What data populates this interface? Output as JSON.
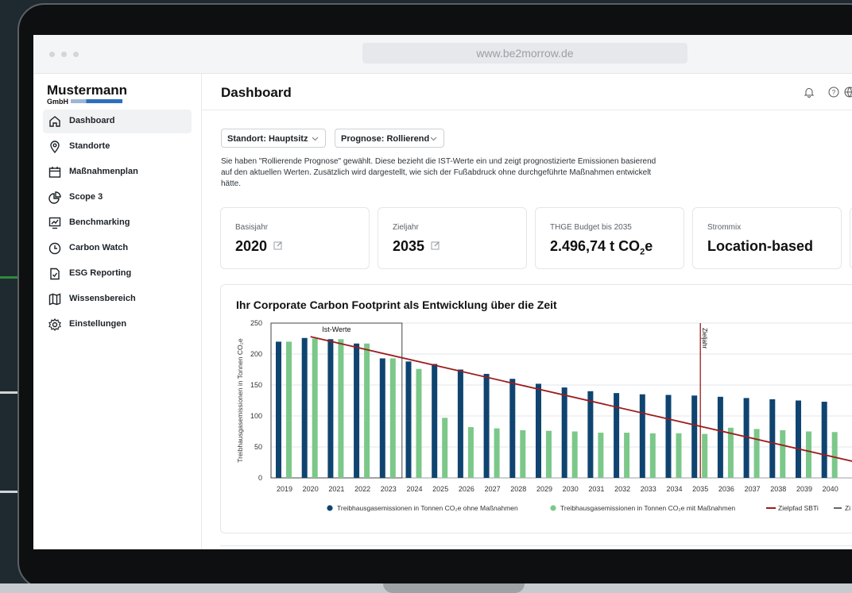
{
  "browser": {
    "url": "www.be2morrow.de"
  },
  "company": {
    "name": "Mustermann",
    "suffix": "GmbH"
  },
  "sidebar": {
    "items": [
      {
        "label": "Dashboard",
        "icon": "home-icon",
        "active": true
      },
      {
        "label": "Standorte",
        "icon": "location-pin-icon"
      },
      {
        "label": "Maßnahmenplan",
        "icon": "calendar-icon"
      },
      {
        "label": "Scope 3",
        "icon": "pie-chart-icon"
      },
      {
        "label": "Benchmarking",
        "icon": "chart-board-icon"
      },
      {
        "label": "Carbon Watch",
        "icon": "clock-icon"
      },
      {
        "label": "ESG Reporting",
        "icon": "document-check-icon"
      },
      {
        "label": "Wissensbereich",
        "icon": "map-icon"
      },
      {
        "label": "Einstellungen",
        "icon": "gear-icon"
      }
    ]
  },
  "header": {
    "title": "Dashboard",
    "icons": [
      "bell-icon",
      "help-icon",
      "globe-icon"
    ]
  },
  "filters": {
    "standort": "Standort: Hauptsitz",
    "prognose": "Prognose: Rollierend"
  },
  "description": "Sie haben \"Rollierende Prognose\" gewählt. Diese bezieht die IST-Werte ein und zeigt prognostizierte Emissionen basierend auf den aktuellen Werten. Zusätzlich wird dargestellt, wie sich der Fußabdruck ohne durchgeführte Maßnahmen entwickelt hätte.",
  "cards": {
    "basisjahr": {
      "label": "Basisjahr",
      "value": "2020"
    },
    "zieljahr": {
      "label": "Zieljahr",
      "value": "2035"
    },
    "budget": {
      "label": "THGE Budget bis 2035",
      "value": "2.496,74 t CO",
      "sub": "2",
      "unit": "e"
    },
    "strommix": {
      "label": "Strommix",
      "value": "Location-based"
    }
  },
  "colors": {
    "dark": "#0f4470",
    "light": "#7cc88a",
    "target": "#9b1c1c",
    "grid": "#e2e5e8"
  },
  "chart_data": {
    "type": "bar",
    "title": "Ihr Corporate Carbon Footprint als Entwicklung über die Zeit",
    "ylabel": "Treibhausgasemissionen in Tonnen CO₂e",
    "ylim": [
      0,
      250
    ],
    "yticks": [
      0,
      50,
      100,
      150,
      200,
      250
    ],
    "categories": [
      "2019",
      "2020",
      "2021",
      "2022",
      "2023",
      "2024",
      "2025",
      "2026",
      "2027",
      "2028",
      "2029",
      "2030",
      "2031",
      "2032",
      "2033",
      "2034",
      "2035",
      "2036",
      "2037",
      "2038",
      "2039",
      "2040"
    ],
    "series": [
      {
        "name": "Treibhausgasemissionen in Tonnen CO₂e ohne Maßnahmen",
        "color": "#0f4470",
        "values": [
          220,
          226,
          224,
          217,
          193,
          188,
          184,
          175,
          168,
          160,
          152,
          146,
          140,
          137,
          135,
          134,
          133,
          131,
          129,
          127,
          125,
          123
        ]
      },
      {
        "name": "Treibhausgasemissionen in Tonnen CO₂e mit Maßnahmen",
        "color": "#7cc88a",
        "values": [
          220,
          225,
          224,
          217,
          193,
          176,
          97,
          82,
          80,
          77,
          76,
          75,
          73,
          73,
          72,
          72,
          71,
          81,
          79,
          77,
          75,
          74
        ]
      }
    ],
    "target_line": {
      "name": "Zielpfad SBTi",
      "from": {
        "year": "2020",
        "value": 228
      },
      "to": {
        "year": "2040",
        "value": 35
      }
    },
    "ist_box": {
      "label": "Ist-Werte",
      "from": "2019",
      "to": "2023"
    },
    "zieljahr_marker": {
      "label": "Zieljahr",
      "year": "2035"
    },
    "legend_cut": "Zi"
  }
}
